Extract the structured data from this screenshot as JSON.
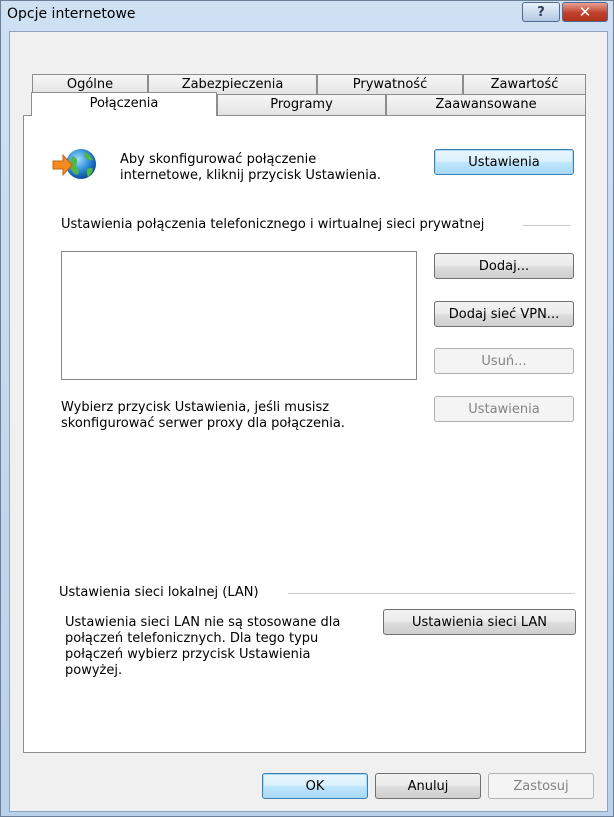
{
  "window": {
    "title": "Opcje internetowe",
    "help_glyph": "?",
    "close_glyph": "✕"
  },
  "tabs": {
    "row1": [
      "Ogólne",
      "Zabezpieczenia",
      "Prywatność",
      "Zawartość"
    ],
    "row2": [
      "Połączenia",
      "Programy",
      "Zaawansowane"
    ],
    "active": "Połączenia"
  },
  "setup": {
    "icon": "network-globe-icon",
    "text_line1": "Aby skonfigurować połączenie",
    "text_line2": "internetowe, kliknij przycisk Ustawienia.",
    "button": "Ustawienia"
  },
  "dialup": {
    "group_label": "Ustawienia połączenia telefonicznego i wirtualnej sieci prywatnej",
    "connections": [],
    "add_button": "Dodaj...",
    "add_vpn_button": "Dodaj sieć VPN...",
    "remove_button": "Usuń...",
    "settings_button": "Ustawienia",
    "proxy_text_line1": "Wybierz przycisk Ustawienia, jeśli musisz",
    "proxy_text_line2": "skonfigurować serwer proxy dla połączenia."
  },
  "lan": {
    "group_label": "Ustawienia sieci lokalnej (LAN)",
    "text_line1": "Ustawienia sieci LAN nie są stosowane dla",
    "text_line2": "połączeń telefonicznych. Dla tego typu",
    "text_line3": "połączeń wybierz przycisk Ustawienia",
    "text_line4": "powyżej.",
    "button": "Ustawienia sieci LAN"
  },
  "footer": {
    "ok": "OK",
    "cancel": "Anuluj",
    "apply": "Zastosuj"
  },
  "colors": {
    "default_button_border": "#3c7fb1",
    "close_button": "#c0412b",
    "disabled_text": "#838383"
  }
}
